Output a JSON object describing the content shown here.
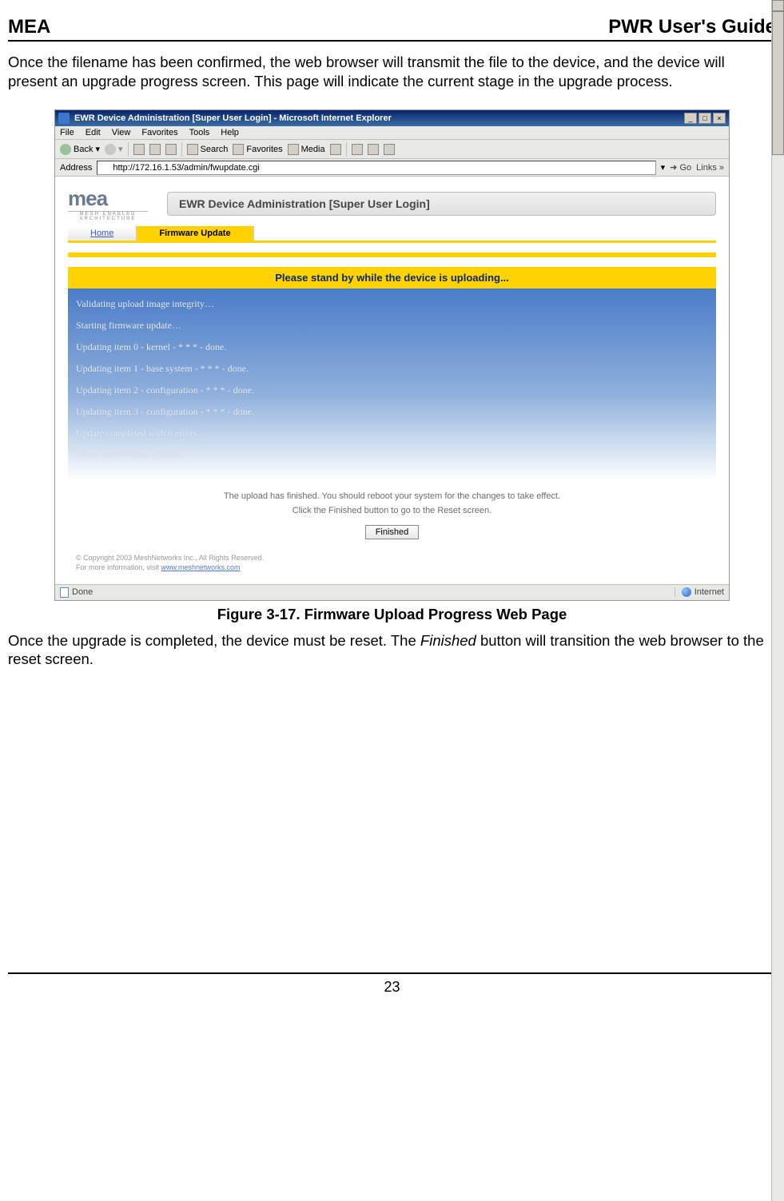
{
  "header": {
    "left": "MEA",
    "right": "PWR User's Guide"
  },
  "intro": "Once the filename has been confirmed, the web browser will transmit the file to the device, and the device will present an upgrade progress screen. This page will indicate the current stage in the upgrade process.",
  "browser": {
    "title": "EWR Device Administration [Super User Login] - Microsoft Internet Explorer",
    "menus": [
      "File",
      "Edit",
      "View",
      "Favorites",
      "Tools",
      "Help"
    ],
    "toolbar": {
      "back": "Back",
      "search": "Search",
      "favorites": "Favorites",
      "media": "Media"
    },
    "address_label": "Address",
    "address_url": "http://172.16.1.53/admin/fwupdate.cgi",
    "go_label": "Go",
    "links_label": "Links »",
    "status_left": "Done",
    "status_right": "Internet"
  },
  "page": {
    "logo_main": "mea",
    "logo_sub": "MESH ENABLED ARCHITECTURE",
    "admin_title": "EWR Device Administration [Super User Login]",
    "tabs": {
      "home": "Home",
      "firmware": "Firmware Update"
    },
    "banner": "Please stand by while the device is uploading...",
    "progress": [
      "Validating upload image integrity…",
      "Starting firmware update…",
      "Updating item 0 - kernel - * * * - done.",
      "Updating item 1 - base system - * * * - done.",
      "Updating item 2 - configuration - * * * - done.",
      "Updating item 3 - configuration - * * * - done.",
      "Update completed with 0 errors.",
      "There were 4 items updated."
    ],
    "finish": {
      "line1": "The upload has finished. You should reboot your system for the changes to take effect.",
      "line2": "Click the Finished button to go to the Reset screen.",
      "button": "Finished"
    },
    "copyright": {
      "line1": "© Copyright 2003 MeshNetworks Inc., All Rights Reserved.",
      "line2_pre": "For more information, visit ",
      "link": "www.meshnetworks.com"
    }
  },
  "caption": "Figure 3-17.   Firmware Upload Progress Web Page",
  "outro_pre": "Once the upgrade is completed, the device must be reset. The ",
  "outro_italic": "Finished",
  "outro_post": " button will transition the web browser to the reset screen.",
  "footer_page": "23"
}
